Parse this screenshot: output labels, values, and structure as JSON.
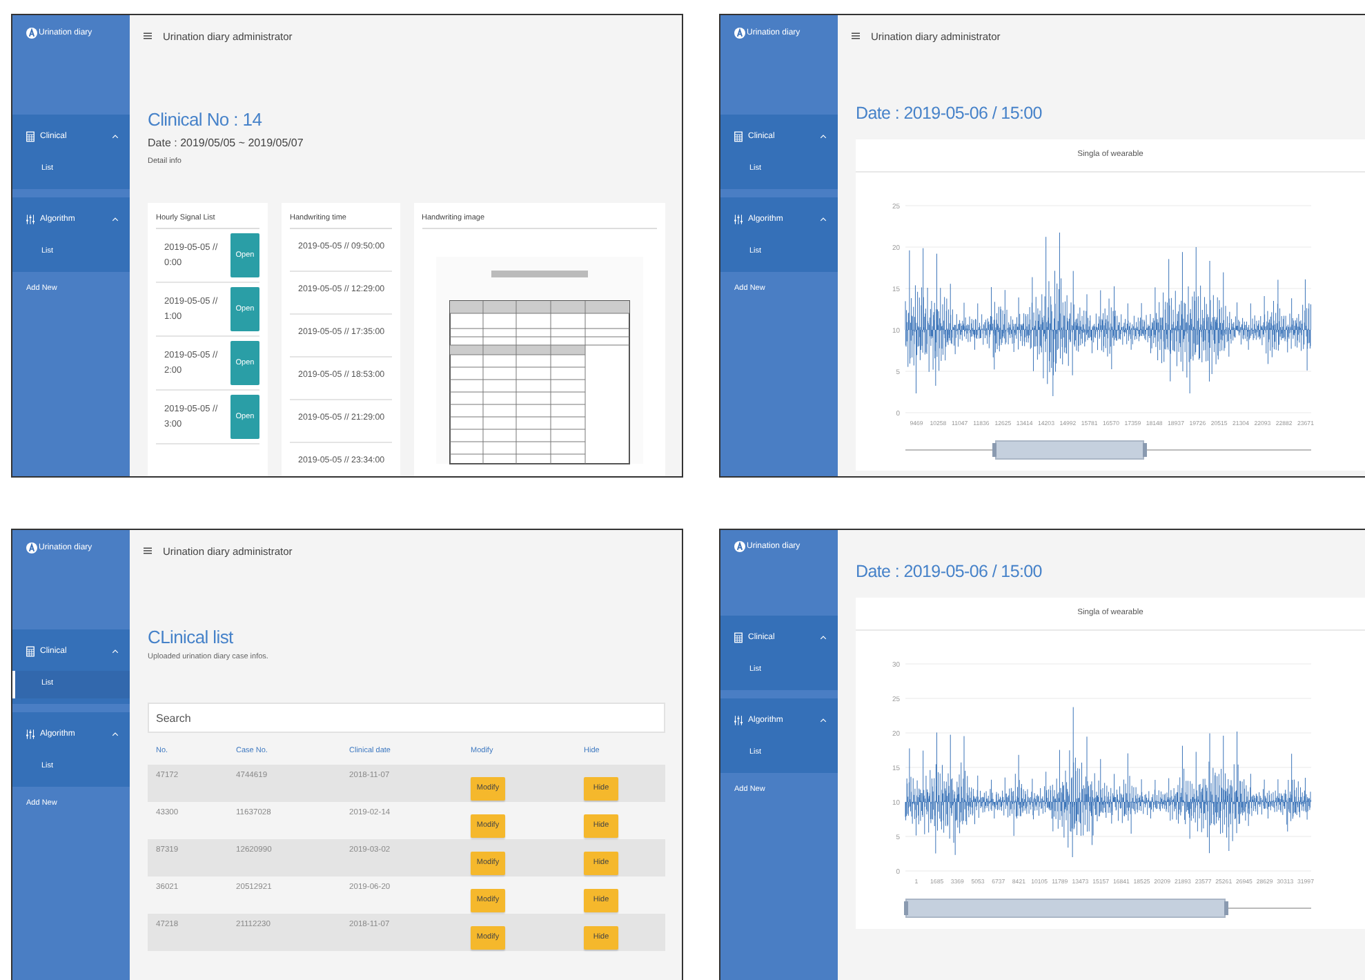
{
  "panels": [
    {
      "kind": "detail",
      "sidebar": {
        "brand": "Urination diary",
        "groups": [
          {
            "kind": "grid",
            "label": "Clinical",
            "expanded": true,
            "items": [
              {
                "label": "List",
                "selected": false
              }
            ]
          },
          {
            "kind": "sliders",
            "label": "Algorithm",
            "expanded": true,
            "items": [
              {
                "label": "List",
                "selected": false
              }
            ]
          }
        ],
        "add_new": "Add New"
      },
      "header": {
        "title": "Urination diary administrator"
      },
      "title": "Clinical No : 14",
      "date": "Date : 2019/05/05 ~ 2019/05/07",
      "subtitle": "Detail info",
      "signal_card": {
        "title": "Hourly Signal List",
        "items": [
          {
            "time": "2019-05-05 // 0:00",
            "button": "Open"
          },
          {
            "time": "2019-05-05 // 1:00",
            "button": "Open"
          },
          {
            "time": "2019-05-05 // 2:00",
            "button": "Open"
          },
          {
            "time": "2019-05-05 // 3:00",
            "button": "Open"
          }
        ]
      },
      "time_card": {
        "title": "Handwriting time",
        "items": [
          "2019-05-05 // 09:50:00",
          "2019-05-05 // 12:29:00",
          "2019-05-05 // 17:35:00",
          "2019-05-05 // 18:53:00",
          "2019-05-05 // 21:29:00",
          "2019-05-05 // 23:34:00"
        ]
      },
      "image_card": {
        "title": "Handwriting image"
      }
    },
    {
      "kind": "signal",
      "sidebar": {
        "brand": "Urination diary",
        "groups": [
          {
            "kind": "grid",
            "label": "Clinical",
            "expanded": true,
            "items": [
              {
                "label": "List",
                "selected": false
              }
            ]
          },
          {
            "kind": "sliders",
            "label": "Algorithm",
            "expanded": true,
            "items": [
              {
                "label": "List",
                "selected": false
              }
            ]
          }
        ],
        "add_new": "Add New"
      },
      "header": {
        "title": "Urination diary administrator"
      },
      "title": "Date : 2019-05-06 / 15:00",
      "chart": {
        "title": "Singla of wearable",
        "zoom_handles": [
          {
            "level": 0.22
          },
          {
            "level": 0.59
          }
        ],
        "y_ticks": [
          "25",
          "20",
          "15",
          "10",
          "5",
          "0"
        ],
        "x_labels": [
          "9469",
          "10258",
          "11047",
          "11836",
          "12625",
          "13414",
          "14203",
          "14992",
          "15781",
          "16570",
          "17359",
          "18148",
          "18937",
          "19726",
          "20515",
          "21304",
          "22093",
          "22882",
          "23671"
        ]
      }
    },
    {
      "kind": "list",
      "sidebar": {
        "brand": "Urination diary",
        "groups": [
          {
            "kind": "grid",
            "label": "Clinical",
            "expanded": true,
            "items": [
              {
                "label": "List",
                "selected": true
              }
            ]
          },
          {
            "kind": "sliders",
            "label": "Algorithm",
            "expanded": true,
            "items": [
              {
                "label": "List",
                "selected": false
              }
            ]
          }
        ],
        "add_new": "Add New"
      },
      "header": {
        "title": "Urination diary administrator"
      },
      "title": "CLinical list",
      "subtitle": "Uploaded urination diary case infos.",
      "search": {
        "placeholder": "Search"
      },
      "table": {
        "columns": [
          "No.",
          "Case No.",
          "Clinical date",
          "Modify",
          "Hide"
        ],
        "rows": [
          {
            "no": "47172",
            "case_no": "4744619",
            "date": "2018-11-07",
            "modify": "Modify",
            "hide": "Hide"
          },
          {
            "no": "43300",
            "case_no": "11637028",
            "date": "2019-02-14",
            "modify": "Modify",
            "hide": "Hide"
          },
          {
            "no": "87319",
            "case_no": "12620990",
            "date": "2019-03-02",
            "modify": "Modify",
            "hide": "Hide"
          },
          {
            "no": "36021",
            "case_no": "20512921",
            "date": "2019-06-20",
            "modify": "Modify",
            "hide": "Hide"
          },
          {
            "no": "47218",
            "case_no": "21112230",
            "date": "2018-11-07",
            "modify": "Modify",
            "hide": "Hide"
          }
        ]
      }
    },
    {
      "kind": "signal",
      "sidebar": {
        "brand": "Urination diary",
        "groups": [
          {
            "kind": "grid",
            "label": "Clinical",
            "expanded": true,
            "items": [
              {
                "label": "List",
                "selected": false
              }
            ]
          },
          {
            "kind": "sliders",
            "label": "Algorithm",
            "expanded": true,
            "items": [
              {
                "label": "List",
                "selected": false
              }
            ]
          }
        ],
        "add_new": "Add New"
      },
      "title": "Date : 2019-05-06 / 15:00",
      "chart": {
        "title": "Singla of wearable",
        "zoom_handles": [
          {
            "level": 0.0
          },
          {
            "level": 0.79
          }
        ],
        "y_ticks": [
          "30",
          "25",
          "20",
          "15",
          "10",
          "5",
          "0"
        ],
        "x_labels": [
          "1",
          "1685",
          "3369",
          "5053",
          "6737",
          "8421",
          "10105",
          "11789",
          "13473",
          "15157",
          "16841",
          "18525",
          "20209",
          "21893",
          "23577",
          "25261",
          "26945",
          "28629",
          "30313",
          "31997"
        ]
      }
    }
  ]
}
